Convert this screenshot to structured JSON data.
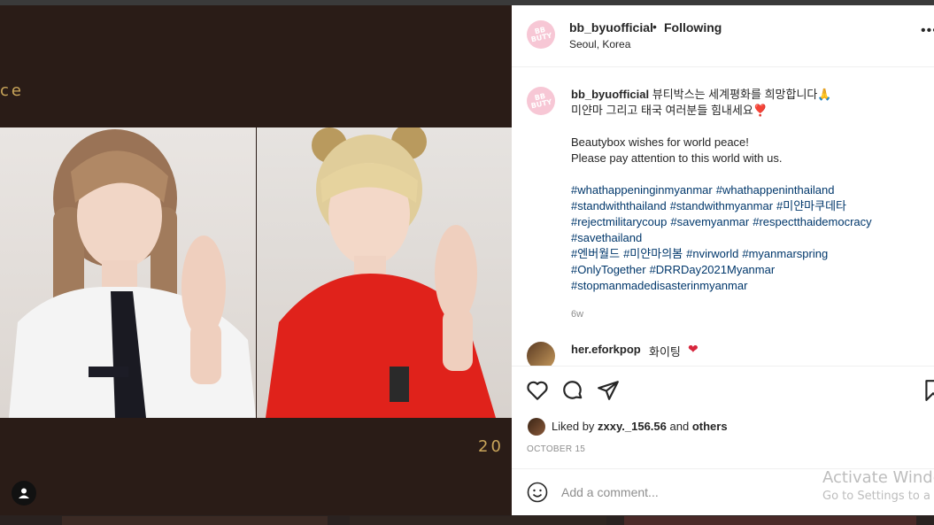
{
  "media": {
    "deco_left": "ce",
    "deco_right": "20"
  },
  "post": {
    "username": "bb_byuofficial",
    "follow_status": "Following",
    "location": "Seoul, Korea",
    "avatar_logo": "BB\nBUTY",
    "caption_line1": "뷰티박스는 세계평화를 희망합니다🙏",
    "caption_line2": "미얀마 그리고 태국 여러분들 힘내세요❣️",
    "caption_en1": "Beautybox wishes for world peace!",
    "caption_en2": "Please pay attention to this world with us.",
    "hashtags": [
      "#whathappeninginmyanmar",
      "#whathappeninthailand",
      "#standwiththailand",
      "#standwithmyanmar",
      "#미얀마쿠데타",
      "#rejectmilitarycoup",
      "#savemyanmar",
      "#respectthaidemocracy",
      "#savethailand",
      "#엔버월드",
      "#미얀마의봄",
      "#nvirworld",
      "#myanmarspring",
      "#OnlyTogether",
      "#DRRDay2021Myanmar",
      "#stopmanmadedisasterinmyanmar"
    ],
    "time_ago": "6w"
  },
  "comment": {
    "username": "her.eforkpop",
    "text": "화이팅"
  },
  "likes": {
    "prefix": "Liked by",
    "user": "zxxy._156.56",
    "connector": "and",
    "others": "others"
  },
  "date": "OCTOBER 15",
  "add_comment": {
    "placeholder": "Add a comment..."
  },
  "watermark": {
    "line1": "Activate Windo",
    "line2": "Go to Settings to a"
  },
  "colors": {
    "link": "#00376b",
    "text": "#262626",
    "muted": "#8e8e8e",
    "heart": "#d7263d"
  }
}
